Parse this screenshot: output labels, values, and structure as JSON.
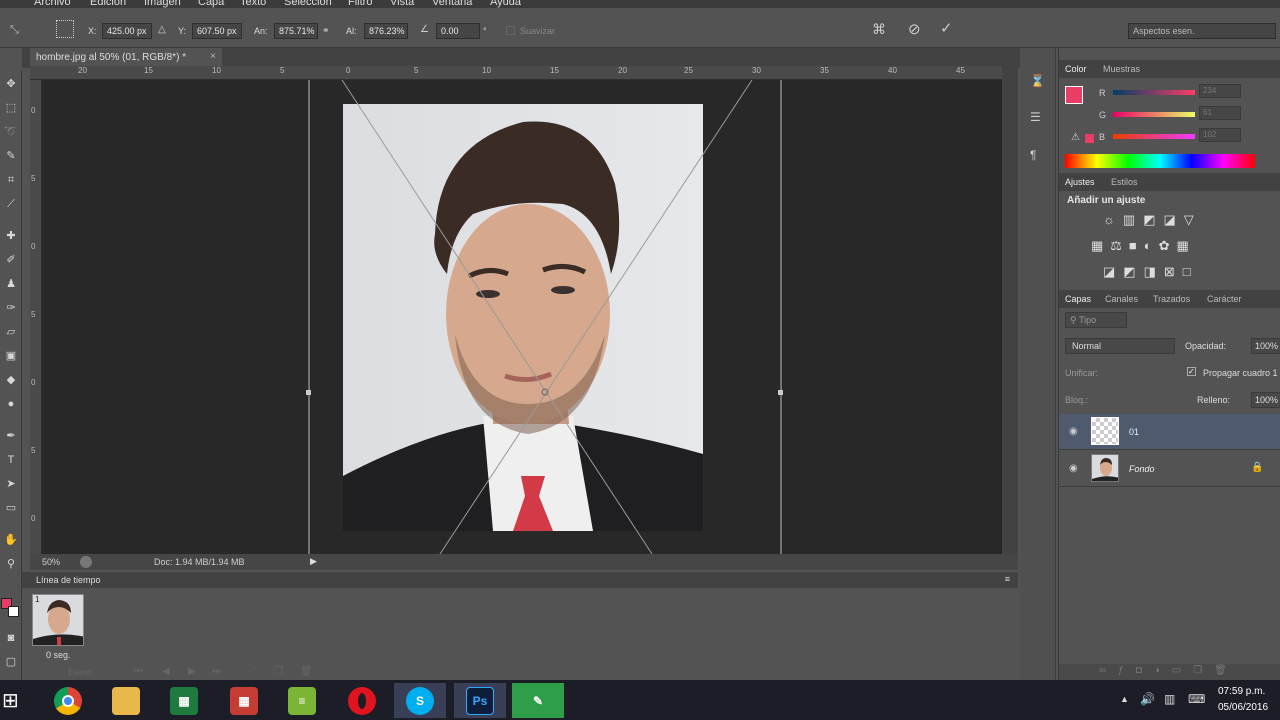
{
  "menu": [
    "Archivo",
    "Edición",
    "Imagen",
    "Capa",
    "Texto",
    "Selección",
    "Filtro",
    "Vista",
    "Ventana",
    "Ayuda"
  ],
  "options": {
    "x_label": "X:",
    "x_value": "425.00 px",
    "y_label": "Y:",
    "y_value": "607.50 px",
    "w_label": "An:",
    "w_value": "875.71%",
    "h_label": "Al:",
    "h_value": "876.23%",
    "angle_value": "0.00",
    "degree": "°",
    "smooth_label": "Suavizar",
    "workspace": "Aspectos esen."
  },
  "document": {
    "tab_title": "hombre.jpg al 50% (01, RGB/8*) *",
    "ruler_h": [
      "20",
      "15",
      "10",
      "5",
      "0",
      "5",
      "10",
      "15",
      "20",
      "25",
      "30",
      "35",
      "40",
      "45"
    ],
    "ruler_v": [
      "0",
      "5",
      "0",
      "5",
      "0",
      "5",
      "0",
      "5",
      "0"
    ],
    "zoom": "50%",
    "doc_size": "Doc: 1.94 MB/1.94 MB"
  },
  "timeline": {
    "title": "Línea de tiempo",
    "frame_number": "1",
    "frame_delay": "0 seg.",
    "loop": "Eterno"
  },
  "color_panel": {
    "tabs": [
      "Color",
      "Muestras"
    ],
    "r_label": "R",
    "g_label": "G",
    "b_label": "B",
    "r_value": "234",
    "g_value": "61",
    "b_value": "102",
    "fg_color": "#ea3d66"
  },
  "adjustments": {
    "tabs": [
      "Ajustes",
      "Estilos"
    ],
    "title": "Añadir un ajuste"
  },
  "layers": {
    "tabs": [
      "Capas",
      "Canales",
      "Trazados",
      "Carácter"
    ],
    "filter": "Tipo",
    "blend": "Normal",
    "opacity_label": "Opacidad:",
    "opacity_value": "100%",
    "unify_label": "Unificar:",
    "propagate_label": "Propagar cuadro 1",
    "lock_label": "Bloq.:",
    "fill_label": "Relleno:",
    "fill_value": "100%",
    "items": [
      {
        "name": "01"
      },
      {
        "name": "Fondo"
      }
    ]
  },
  "taskbar": {
    "time": "07:59 p.m.",
    "date": "05/06/2016",
    "ps_label": "Ps"
  }
}
